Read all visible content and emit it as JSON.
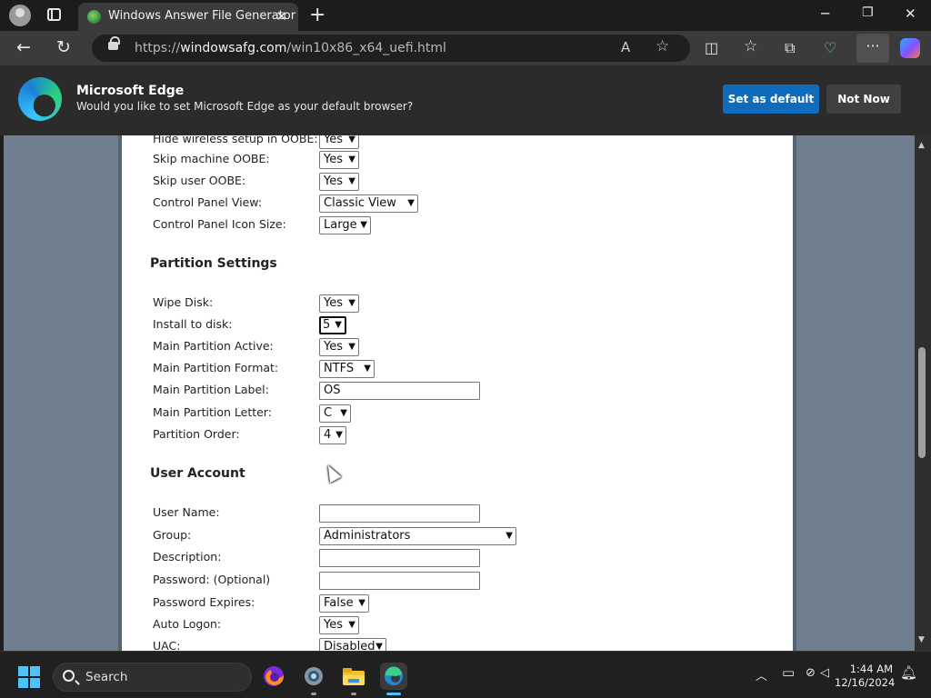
{
  "browser": {
    "tab_title": "Windows Answer File Generator",
    "url_scheme": "https://",
    "url_host": "windowsafg.com",
    "url_path": "/win10x86_x64_uefi.html",
    "more_label": "···"
  },
  "banner": {
    "title": "Microsoft Edge",
    "subtitle": "Would you like to set Microsoft Edge as your default browser?",
    "set_default_label": "Set as default",
    "not_now_label": "Not Now"
  },
  "form": {
    "oobe_rows": [
      {
        "label": "Hide wireless setup in OOBE:",
        "value": "Yes"
      },
      {
        "label": "Skip machine OOBE:",
        "value": "Yes"
      },
      {
        "label": "Skip user OOBE:",
        "value": "Yes"
      },
      {
        "label": "Control Panel View:",
        "value": "Classic View"
      },
      {
        "label": "Control Panel Icon Size:",
        "value": "Large"
      }
    ],
    "partition_heading": "Partition Settings",
    "partition_rows": [
      {
        "label": "Wipe Disk:",
        "value": "Yes"
      },
      {
        "label": "Install to disk:",
        "value": "5"
      },
      {
        "label": "Main Partition Active:",
        "value": "Yes"
      },
      {
        "label": "Main Partition Format:",
        "value": "NTFS"
      },
      {
        "label": "Main Partition Label:",
        "value": "OS"
      },
      {
        "label": "Main Partition Letter:",
        "value": "C"
      },
      {
        "label": "Partition Order:",
        "value": "4"
      }
    ],
    "user_heading": "User Account",
    "user_rows": [
      {
        "label": "User Name:",
        "value": ""
      },
      {
        "label": "Group:",
        "value": "Administrators"
      },
      {
        "label": "Description:",
        "value": ""
      },
      {
        "label": "Password: (Optional)",
        "value": ""
      },
      {
        "label": "Password Expires:",
        "value": "False"
      },
      {
        "label": "Auto Logon:",
        "value": "Yes"
      },
      {
        "label": "UAC:",
        "value": "Disabled"
      }
    ]
  },
  "taskbar": {
    "search_label": "Search",
    "time": "1:44 AM",
    "date": "12/16/2024"
  },
  "scroll": {
    "thumb_position": 0.42
  },
  "colors": {
    "accent": "#0f6cbd",
    "page_background": "#6f7f90",
    "taskbar_accent": "#4cc2ff"
  },
  "icons": [
    "profile-icon",
    "tabs-icon",
    "globe-icon",
    "close-icon",
    "plus-icon",
    "minimize-icon",
    "restore-icon",
    "back-icon",
    "refresh-icon",
    "lock-icon",
    "read-aloud-icon",
    "favorite-star-icon",
    "split-screen-icon",
    "favorites-icon",
    "collections-icon",
    "performance-icon",
    "more-icon",
    "copilot-icon",
    "edge-logo-icon",
    "windows-start-icon",
    "search-icon",
    "firefox-icon",
    "settings-icon",
    "file-explorer-icon",
    "edge-icon",
    "chevron-up-icon",
    "pen-icon",
    "network-icon",
    "speaker-icon",
    "bell-icon"
  ]
}
